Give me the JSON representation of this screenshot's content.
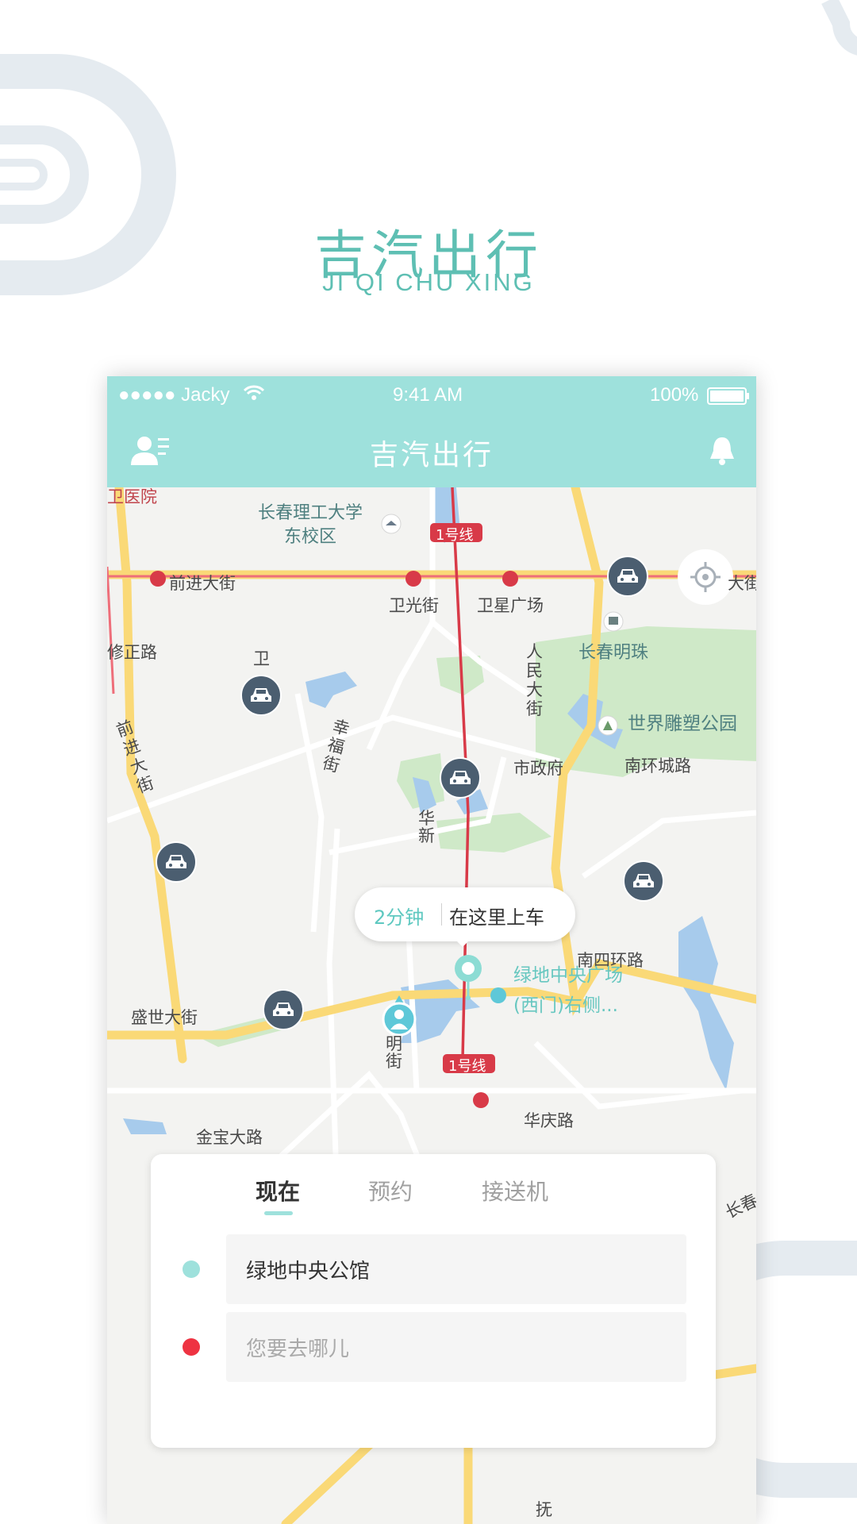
{
  "brand": {
    "name_cn": "吉汽出行",
    "name_en": "JI QI CHU XING",
    "accent": "#5ebfb3"
  },
  "status_bar": {
    "carrier": "●●●●● Jacky",
    "time": "9:41 AM",
    "battery": "100%"
  },
  "nav_bar": {
    "title": "吉汽出行",
    "left_icon": "user-menu-icon",
    "right_icon": "bell-icon",
    "background": "#9ee1dc"
  },
  "map": {
    "labels": {
      "hospital": "卫医院",
      "university": "长春理工大学\n东校区",
      "qianjin_top": "前进大街",
      "weiguang": "卫光街",
      "weixing": "卫星广场",
      "line1_top": "1号线",
      "daje": "大街",
      "mingzhu": "长春明珠",
      "xiuzheng": "修正路",
      "wei": "卫",
      "renmin": "人\n民\n大\n街",
      "park": "世界雕塑公园",
      "qianjin_side": "前\n进\n大\n街",
      "xingfu": "幸\n福\n街",
      "shizhengfu": "市政府",
      "nanhuan": "南环城路",
      "huaxin": "华\n新",
      "nansi": "南四环路",
      "shengshi": "盛世大街",
      "ming": "明\n街",
      "line1_bottom": "1号线",
      "huaqing": "华庆路",
      "jinbao": "金宝大路",
      "changchun": "长春",
      "fu": "抚"
    }
  },
  "pickup_callout": {
    "eta": "2分钟",
    "text": "在这里上车"
  },
  "pickup_pin_label": "绿地中央广场\n(西门)右侧...",
  "ride_panel": {
    "tabs": [
      "现在",
      "预约",
      "接送机"
    ],
    "active_tab": 0,
    "origin_value": "绿地中央公馆",
    "destination_placeholder": "您要去哪儿",
    "origin_dot_color": "#9ee1dc",
    "destination_dot_color": "#ee3342"
  }
}
